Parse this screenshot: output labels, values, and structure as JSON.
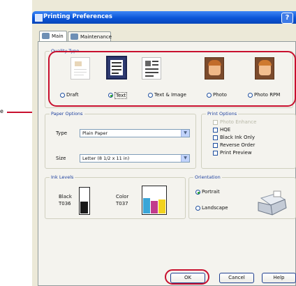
{
  "window": {
    "title": "Printing Preferences",
    "help_label": "?"
  },
  "tabs": [
    {
      "label": "Main"
    },
    {
      "label": "Maintenance"
    }
  ],
  "quality": {
    "group_label": "Quality Type",
    "options": [
      {
        "label": "Draft",
        "selected": false
      },
      {
        "label": "Text",
        "selected": true
      },
      {
        "label": "Text & Image",
        "selected": false
      },
      {
        "label": "Photo",
        "selected": false
      },
      {
        "label": "Photo RPM",
        "selected": false
      }
    ]
  },
  "callout": {
    "label": "e"
  },
  "paper_options": {
    "group_label": "Paper Options",
    "type_label": "Type",
    "type_value": "Plain Paper",
    "size_label": "Size",
    "size_value": "Letter (8 1/2 x 11 in)"
  },
  "print_options": {
    "group_label": "Print Options",
    "items": [
      {
        "label": "Photo Enhance",
        "checked": false,
        "enabled": false
      },
      {
        "label": "HQE",
        "checked": false,
        "enabled": true
      },
      {
        "label": "Black Ink Only",
        "checked": false,
        "enabled": true
      },
      {
        "label": "Reverse Order",
        "checked": false,
        "enabled": true
      },
      {
        "label": "Print Preview",
        "checked": false,
        "enabled": true
      }
    ]
  },
  "ink_levels": {
    "group_label": "Ink Levels",
    "black_label": "Black",
    "black_code": "T036",
    "color_label": "Color",
    "color_code": "T037",
    "black_level": 0.45,
    "color_levels": [
      0.55,
      0.45,
      0.5
    ],
    "colors": {
      "black": "#1a1a1a",
      "cyan": "#3aa6d8",
      "magenta": "#c23b8c",
      "yellow": "#f2d21e"
    }
  },
  "orientation": {
    "group_label": "Orientation",
    "options": [
      {
        "label": "Portrait",
        "selected": true
      },
      {
        "label": "Landscape",
        "selected": false
      }
    ]
  },
  "buttons": {
    "ok": "OK",
    "cancel": "Cancel",
    "help": "Help"
  },
  "highlight_color": "#c8102e"
}
